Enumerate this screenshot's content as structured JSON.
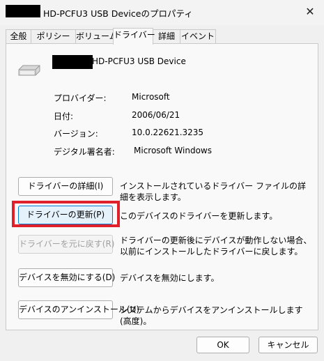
{
  "window": {
    "title": "HD-PCFU3 USB Deviceのプロパティ",
    "close_glyph": "✕"
  },
  "tabs": [
    {
      "label": "全般"
    },
    {
      "label": "ポリシー"
    },
    {
      "label": "ボリューム"
    },
    {
      "label": "ドライバー",
      "active": true
    },
    {
      "label": "詳細"
    },
    {
      "label": "イベント"
    }
  ],
  "device": {
    "name": "HD-PCFU3 USB Device",
    "icon": "drive-icon"
  },
  "info": {
    "provider_label": "プロバイダー:",
    "provider_value": "Microsoft",
    "date_label": "日付:",
    "date_value": "2006/06/21",
    "version_label": "バージョン:",
    "version_value": "10.0.22621.3235",
    "signer_label": "デジタル署名者:",
    "signer_value": "Microsoft Windows"
  },
  "actions": {
    "details_button": "ドライバーの詳細(I)",
    "details_desc": "インストールされているドライバー ファイルの詳細を表示します。",
    "update_button": "ドライバーの更新(P)",
    "update_desc": "このデバイスのドライバーを更新します。",
    "rollback_button": "ドライバーを元に戻す(R)",
    "rollback_desc": "ドライバーの更新後にデバイスが動作しない場合、以前にインストールしたドライバーに戻します。",
    "disable_button": "デバイスを無効にする(D)",
    "disable_desc": "デバイスを無効にします。",
    "uninstall_button": "デバイスのアンインストール(U)",
    "uninstall_desc": "システムからデバイスをアンインストールします (高度)。"
  },
  "footer": {
    "ok": "OK",
    "cancel": "キャンセル"
  },
  "colors": {
    "highlight": "#e0202a",
    "focus": "#0078d4"
  }
}
